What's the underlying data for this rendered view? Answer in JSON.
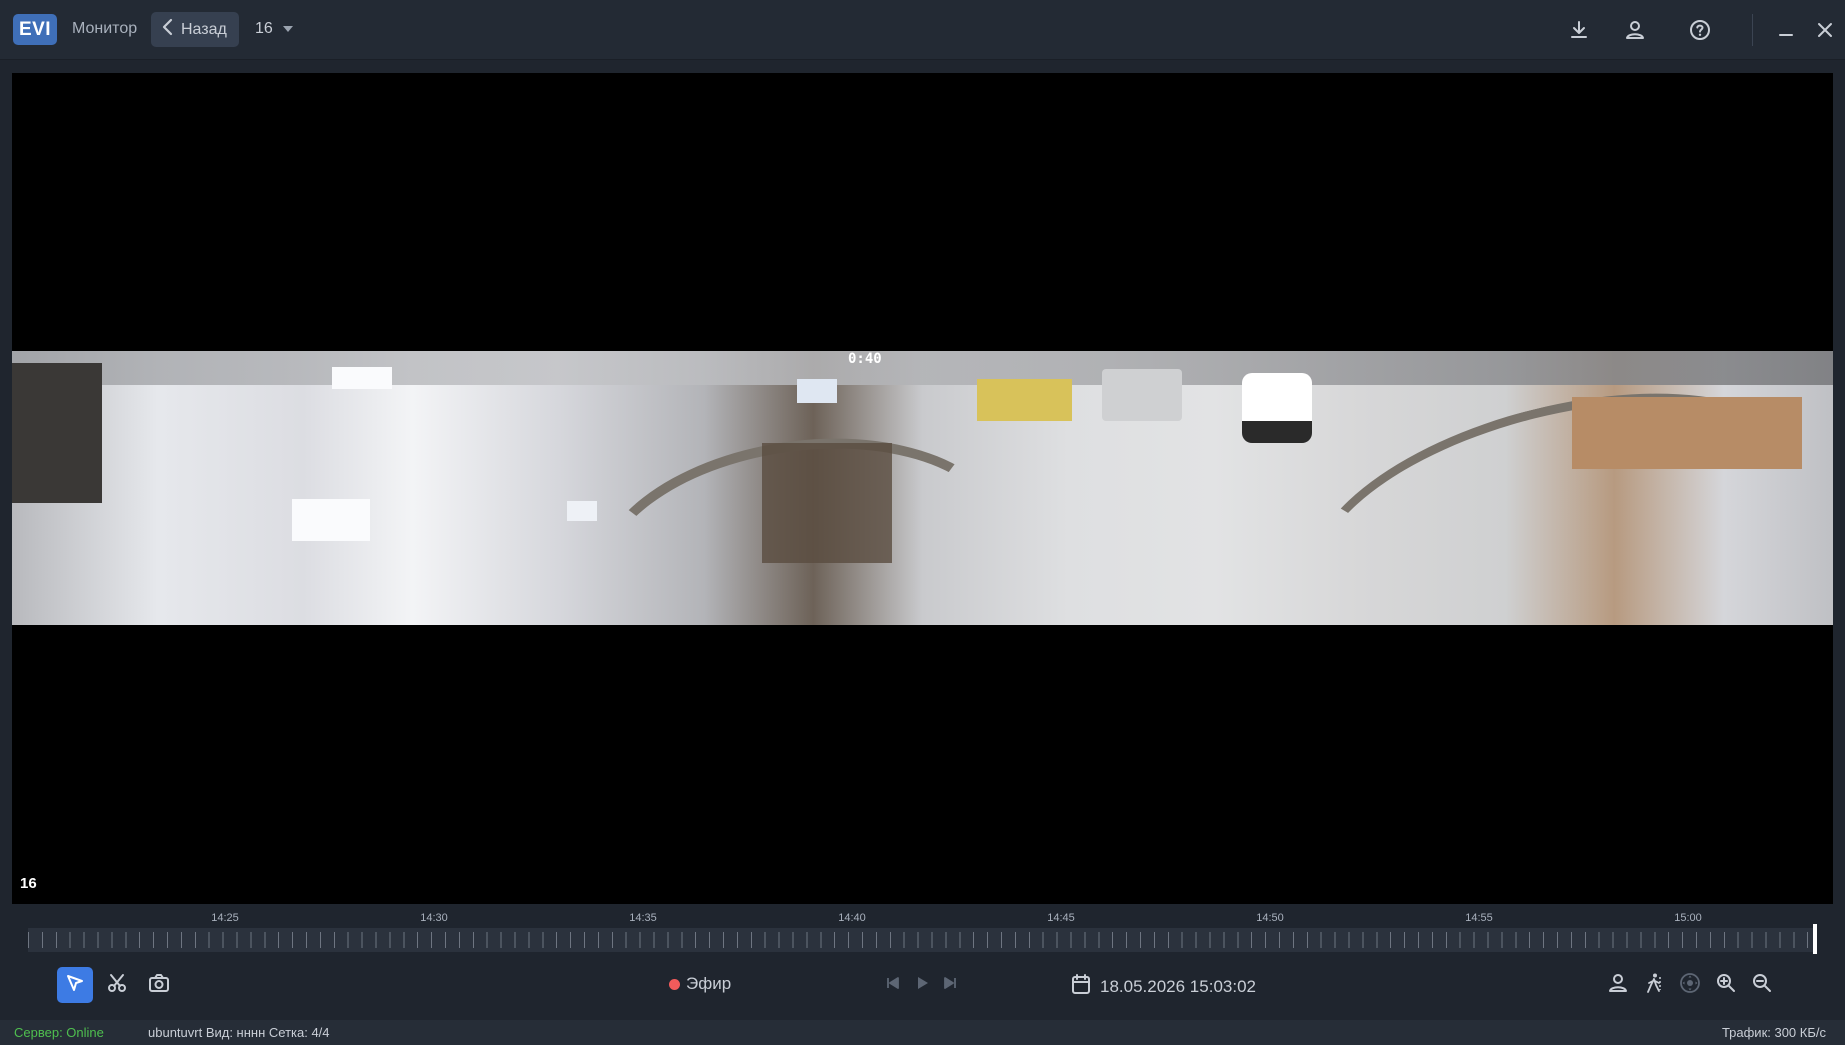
{
  "header": {
    "logo": "EVI",
    "monitor_label": "Монитор",
    "back_label": "Назад",
    "layout_value": "16"
  },
  "video": {
    "osd_time": "0:40",
    "tile_label": "16"
  },
  "timeline": {
    "labels": [
      "14:25",
      "14:30",
      "14:35",
      "14:40",
      "14:45",
      "14:50",
      "14:55",
      "15:00"
    ]
  },
  "toolbar": {
    "live_label": "Эфир",
    "datetime": "18.05.2026 15:03:02"
  },
  "status": {
    "server": "Сервер: Online",
    "info": "ubuntuvrt  Вид: нннн  Сетка: 4/4",
    "traffic": "Трафик: 300 КБ/с"
  },
  "colors": {
    "accent": "#3d7be4",
    "live_dot": "#f25b5b",
    "online": "#4fbf4f"
  }
}
